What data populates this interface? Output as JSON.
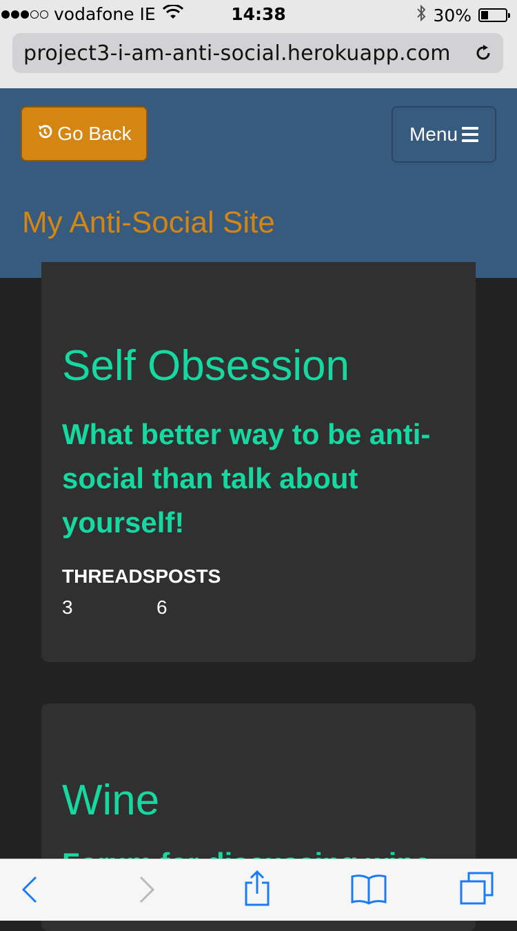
{
  "status_bar": {
    "carrier": "vodafone IE",
    "time": "14:38",
    "battery": "30%",
    "battery_level": 0.3
  },
  "browser": {
    "url": "project3-i-am-anti-social.herokuapp.com"
  },
  "header": {
    "go_back_label": "Go Back",
    "menu_label": "Menu",
    "brand": "My Anti-Social Site"
  },
  "forums": [
    {
      "title": "Self Obsession",
      "description": "What better way to be anti-social than talk about yourself!",
      "threads_label": "THREADS",
      "posts_label": "POSTS",
      "threads": "3",
      "posts": "6"
    },
    {
      "title": "Wine",
      "description": "Forum for discussing wine"
    }
  ],
  "colors": {
    "header_bg": "#375a7f",
    "accent_orange": "#d58512",
    "accent_teal": "#16d9a2",
    "card_bg": "#303030",
    "page_bg": "#222222"
  }
}
